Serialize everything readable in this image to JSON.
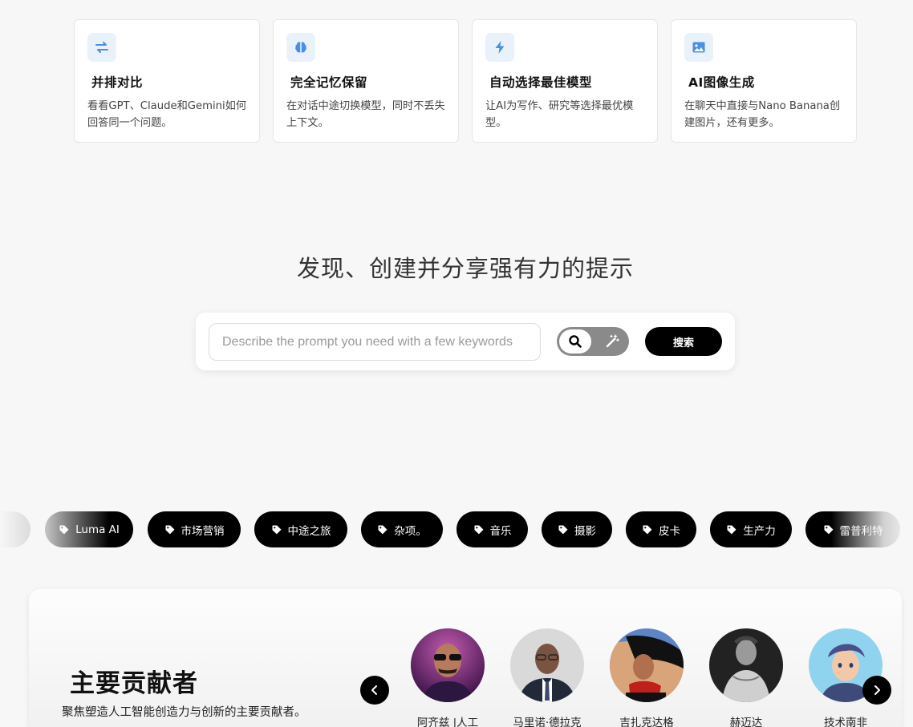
{
  "features": [
    {
      "icon": "swap-arrows-icon",
      "title": "并排对比",
      "desc": "看看GPT、Claude和Gemini如何回答同一个问题。"
    },
    {
      "icon": "brain-icon",
      "title": "完全记忆保留",
      "desc": "在对话中途切换模型，同时不丢失上下文。"
    },
    {
      "icon": "lightning-icon",
      "title": "自动选择最佳模型",
      "desc": "让AI为写作、研究等选择最优模型。"
    },
    {
      "icon": "image-icon",
      "title": "AI图像生成",
      "desc": "在聊天中直接与Nano Banana创建图片，还有更多。"
    }
  ],
  "hero": {
    "title": "发现、创建并分享强有力的提示",
    "search_placeholder": "Describe the prompt you need with a few keywords",
    "search_button": "搜索"
  },
  "tags": [
    "Luma AI",
    "市场营销",
    "中途之旅",
    "杂项。",
    "音乐",
    "摄影",
    "皮卡",
    "生产力",
    "雷普利特"
  ],
  "contributors": {
    "title": "主要贡献者",
    "subtitle": "聚焦塑造人工智能创造力与创新的主要贡献者。",
    "people": [
      {
        "name": "阿齐兹 |人工"
      },
      {
        "name": "马里诺·德拉克"
      },
      {
        "name": "吉扎克达格"
      },
      {
        "name": "赫迈达"
      },
      {
        "name": "技术南非"
      }
    ]
  },
  "colors": {
    "accent_icon": "#4a90e2",
    "icon_bg": "#e9f1fb",
    "button": "#000000"
  }
}
